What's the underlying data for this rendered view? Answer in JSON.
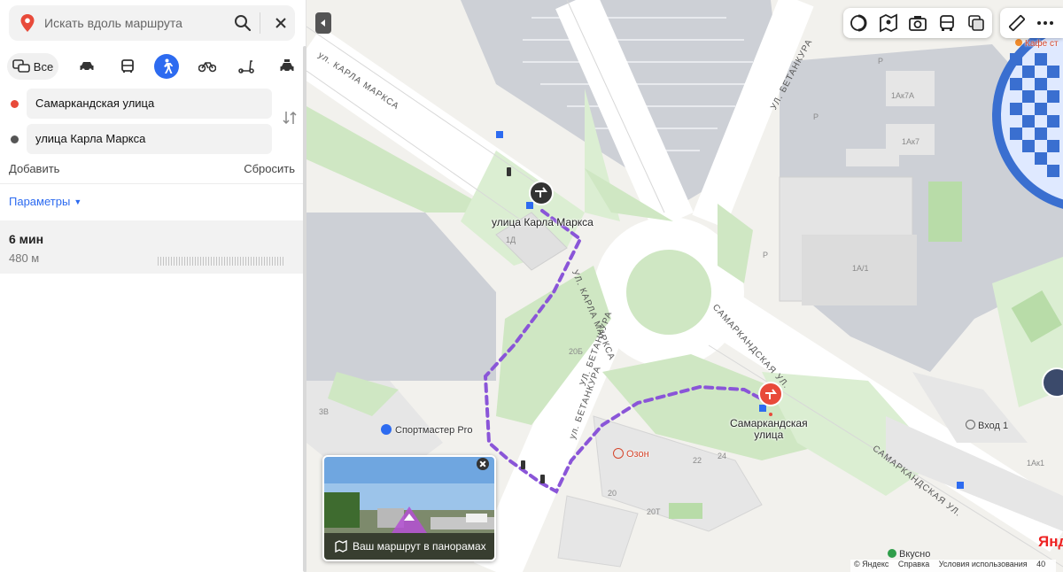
{
  "search": {
    "placeholder": "Искать вдоль маршрута"
  },
  "icons": {
    "pin": "location-pin-icon",
    "search": "search-icon",
    "close": "close-icon",
    "swap": "swap-arrows-icon"
  },
  "transport_modes": {
    "all_label": "Все",
    "items": [
      "all",
      "car",
      "bus",
      "pedestrian",
      "bicycle",
      "scooter",
      "taxi"
    ],
    "active": "pedestrian"
  },
  "route_points": [
    {
      "label": "Самаркандская улица",
      "color": "#e84a3a"
    },
    {
      "label": "улица Карла Маркса",
      "color": "#555555"
    }
  ],
  "actions": {
    "add": "Добавить",
    "reset": "Сбросить"
  },
  "params_label": "Параметры",
  "route": {
    "time": "6 мин",
    "distance": "480 м"
  },
  "map": {
    "streets": {
      "karla_marksa_top": "ул. КАРЛА МАРКСА",
      "karla_marksa_diag": "УЛ. КАРЛА МАРКСА",
      "betankura_top": "УЛ. БЕТАНКУРА",
      "betankura_mid": "УЛ. БЕТАНКУРА",
      "betankura_low": "ул. БЕТАНКУРА",
      "samarkandskaya_1": "САМАРКАНДСКАЯ УЛ.",
      "samarkandskaya_2": "САМАРКАНДСКАЯ УЛ."
    },
    "start_label": "улица Карла Маркса",
    "finish_label": "Самаркандская\nулица",
    "pois": {
      "sportmaster": "Спортмастер Pro",
      "ozon": "Озон",
      "cafe": "Кафе ст",
      "entrance": "Вход 1",
      "vkusno": "Вкусно"
    },
    "buildings": [
      "1Ак7А",
      "1Ак7",
      "1А/1",
      "1Д",
      "20Б",
      "3В",
      "22",
      "24",
      "20",
      "20Т",
      "1Ак1",
      "Р"
    ],
    "panorama_caption": "Ваш маршрут в панорамах",
    "footer": [
      "© Яндекс",
      "Справка",
      "Условия использования"
    ],
    "logo": "Янд",
    "scale_tail": "40"
  },
  "colors": {
    "accent": "#2d6bf0",
    "route": "#8a55d8",
    "finish": "#e84a3a",
    "park": "#cfe7c3"
  }
}
